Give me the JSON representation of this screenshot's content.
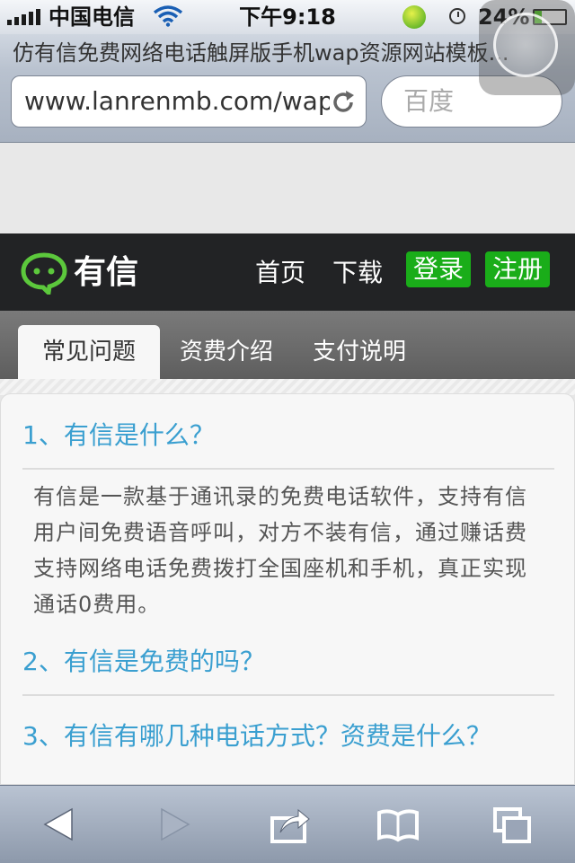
{
  "status_bar": {
    "carrier": "中国电信",
    "time": "下午9:18",
    "battery": "24%",
    "battery_level": 0.24,
    "icons": [
      "signal-icon",
      "wifi-icon",
      "app-badge-icon",
      "clock-icon",
      "battery-charging-icon"
    ]
  },
  "browser": {
    "page_title": "仿有信免费网络电话触屏版手机wap资源网站模板...",
    "url": "www.lanrenmb.com/wap",
    "search_placeholder": "百度",
    "icons": [
      "reload-icon",
      "assistive-touch-icon"
    ]
  },
  "site": {
    "logo_text": "有信",
    "nav": {
      "home": "首页",
      "download": "下载",
      "login": "登录",
      "register": "注册"
    },
    "brand_color": "#1aad19"
  },
  "tabs": [
    {
      "label": "常见问题",
      "active": true
    },
    {
      "label": "资费介绍",
      "active": false
    },
    {
      "label": "支付说明",
      "active": false
    }
  ],
  "faq": [
    {
      "question": "1、有信是什么？",
      "answer": "有信是一款基于通讯录的免费电话软件，支持有信用户间免费语音呼叫，对方不装有信，通过赚话费支持网络电话免费拨打全国座机和手机，真正实现通话0费用。"
    },
    {
      "question": "2、有信是免费的吗？"
    },
    {
      "question": "3、有信有哪几种电话方式？资费是什么？"
    }
  ],
  "toolbar": {
    "icons": [
      "back-arrow-icon",
      "forward-arrow-icon",
      "share-icon",
      "bookmarks-book-icon",
      "tabs-pages-icon"
    ]
  }
}
